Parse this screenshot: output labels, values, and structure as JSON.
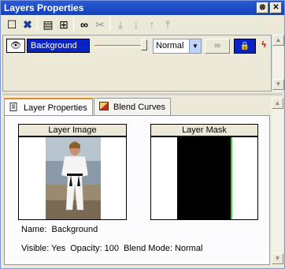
{
  "window": {
    "title": "Layers Properties",
    "pin_glyph": "⊗",
    "close_glyph": "✕"
  },
  "toolbar": {
    "icons": [
      {
        "name": "new-layer-icon",
        "glyph": "☐",
        "color": "#506080"
      },
      {
        "name": "delete-layer-icon",
        "glyph": "✖",
        "color": "#1e3c9c"
      },
      {
        "name": "layer-options-icon",
        "glyph": "▤",
        "color": "#404040"
      },
      {
        "name": "merge-layer-icon",
        "glyph": "⊞",
        "color": "#404040"
      },
      {
        "name": "visibility-glasses-icon",
        "glyph": "∞",
        "color": "#202020"
      },
      {
        "name": "hide-glasses-icon",
        "glyph": "✂",
        "color": "#909090"
      },
      {
        "name": "move-to-bottom-icon",
        "glyph": "⤓",
        "color": "#a0a0a0"
      },
      {
        "name": "move-down-icon",
        "glyph": "↓",
        "color": "#a0a0a0"
      },
      {
        "name": "move-up-icon",
        "glyph": "↑",
        "color": "#a0a0a0"
      },
      {
        "name": "move-to-top-icon",
        "glyph": "⤒",
        "color": "#a0a0a0"
      }
    ]
  },
  "layer_row": {
    "eye_glyph": "👁",
    "name": "Background",
    "opacity_percent": 100,
    "blend_mode": "Normal",
    "dropdown_glyph": "▼",
    "link_glyph": "∞",
    "lock_glyph": "🔒",
    "effect_glyph": "ϟ"
  },
  "scroll": {
    "up_glyph": "▲",
    "down_glyph": "▼"
  },
  "tabs": [
    {
      "label": "Layer Properties",
      "active": true
    },
    {
      "label": "Blend Curves",
      "active": false
    }
  ],
  "panel": {
    "layer_image_label": "Layer Image",
    "layer_mask_label": "Layer Mask",
    "name_label": "Name:",
    "name_value": "Background",
    "visible_label": "Visible:",
    "visible_value": "Yes",
    "opacity_label": "Opacity:",
    "opacity_value": "100",
    "blend_label": "Blend Mode:",
    "blend_value": "Normal"
  },
  "colors": {
    "title_bar": "#1540b8",
    "selection": "#0a24c4",
    "tab_accent": "#e68b2c",
    "mask_edge": "#3cd23c"
  }
}
